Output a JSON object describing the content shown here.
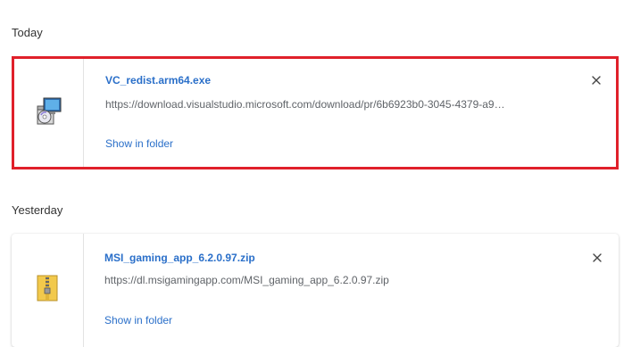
{
  "sections": [
    {
      "label": "Today",
      "item": {
        "filename": "VC_redist.arm64.exe",
        "url": "https://download.visualstudio.microsoft.com/download/pr/6b6923b0-3045-4379-a9…",
        "action": "Show in folder",
        "icon": "installer-icon",
        "highlighted": true
      }
    },
    {
      "label": "Yesterday",
      "item": {
        "filename": "MSI_gaming_app_6.2.0.97.zip",
        "url": "https://dl.msigamingapp.com/MSI_gaming_app_6.2.0.97.zip",
        "action": "Show in folder",
        "icon": "zip-archive-icon",
        "highlighted": false
      }
    }
  ],
  "colors": {
    "link": "#2a6fc9",
    "highlight_border": "#e0202a",
    "url_text": "#5f6368"
  }
}
